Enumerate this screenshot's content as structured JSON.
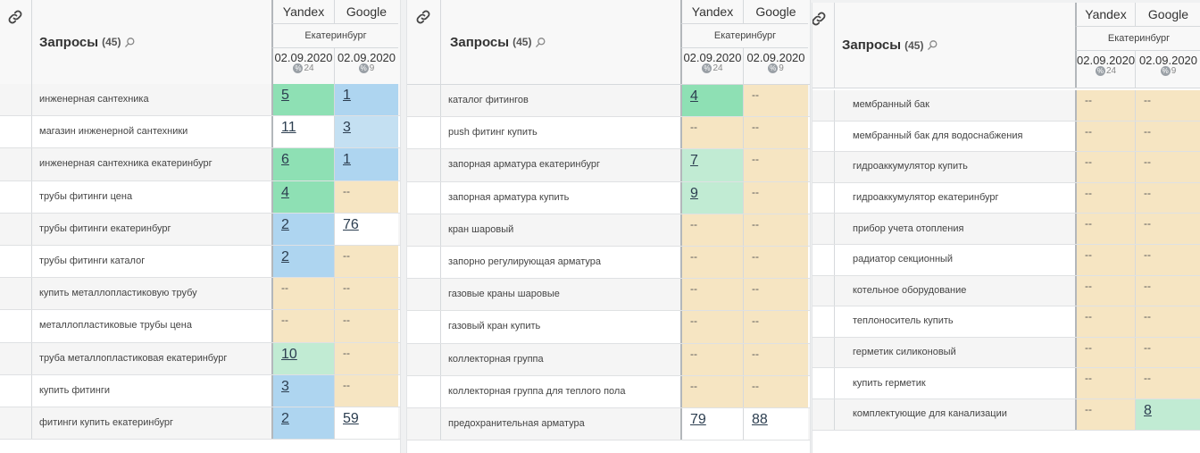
{
  "colors": {
    "green": "#8ee0b4",
    "lightgreen": "#c1ebd3",
    "blue": "#aed5f0",
    "lightblue": "#c4e0f2",
    "beige": "#f6e5c2",
    "white": "#ffffff"
  },
  "icons": {
    "link": "link-icon",
    "search": "search-icon",
    "percent": "percent-icon"
  },
  "panels": [
    {
      "header": {
        "title": "Запросы",
        "count": "(45)",
        "yandex": "Yandex",
        "google": "Google",
        "region": "Екатеринбург",
        "yandex_date": "02.09.2020",
        "yandex_sub": "24",
        "google_date": "02.09.2020",
        "google_sub": "9",
        "percent_symbol": "%"
      },
      "rows": [
        {
          "query": "инженерная сантехника",
          "yandex": "5",
          "google": "1",
          "y_color": "green",
          "g_color": "blue"
        },
        {
          "query": "магазин инженерной сантехники",
          "yandex": "11",
          "google": "3",
          "y_color": "white",
          "g_color": "lightblue"
        },
        {
          "query": "инженерная сантехника екатеринбург",
          "yandex": "6",
          "google": "1",
          "y_color": "green",
          "g_color": "blue"
        },
        {
          "query": "трубы фитинги цена",
          "yandex": "4",
          "google": "--",
          "y_color": "green",
          "g_color": "beige"
        },
        {
          "query": "трубы фитинги екатеринбург",
          "yandex": "2",
          "google": "76",
          "y_color": "blue",
          "g_color": "white"
        },
        {
          "query": "трубы фитинги каталог",
          "yandex": "2",
          "google": "--",
          "y_color": "blue",
          "g_color": "beige"
        },
        {
          "query": "купить металлопластиковую трубу",
          "yandex": "--",
          "google": "--",
          "y_color": "beige",
          "g_color": "beige"
        },
        {
          "query": "металлопластиковые трубы цена",
          "yandex": "--",
          "google": "--",
          "y_color": "beige",
          "g_color": "beige"
        },
        {
          "query": "труба металлопластиковая екатеринбург",
          "yandex": "10",
          "google": "--",
          "y_color": "lightgreen",
          "g_color": "beige"
        },
        {
          "query": "купить фитинги",
          "yandex": "3",
          "google": "--",
          "y_color": "blue",
          "g_color": "beige"
        },
        {
          "query": "фитинги купить екатеринбург",
          "yandex": "2",
          "google": "59",
          "y_color": "blue",
          "g_color": "white"
        }
      ]
    },
    {
      "header": {
        "title": "Запросы",
        "count": "(45)",
        "yandex": "Yandex",
        "google": "Google",
        "region": "Екатеринбург",
        "yandex_date": "02.09.2020",
        "yandex_sub": "24",
        "google_date": "02.09.2020",
        "google_sub": "9",
        "percent_symbol": "%"
      },
      "rows": [
        {
          "query": "каталог фитингов",
          "yandex": "4",
          "google": "--",
          "y_color": "green",
          "g_color": "beige"
        },
        {
          "query": "push фитинг купить",
          "yandex": "--",
          "google": "--",
          "y_color": "beige",
          "g_color": "beige"
        },
        {
          "query": "запорная арматура екатеринбург",
          "yandex": "7",
          "google": "--",
          "y_color": "lightgreen",
          "g_color": "beige"
        },
        {
          "query": "запорная арматура купить",
          "yandex": "9",
          "google": "--",
          "y_color": "lightgreen",
          "g_color": "beige"
        },
        {
          "query": "кран шаровый",
          "yandex": "--",
          "google": "--",
          "y_color": "beige",
          "g_color": "beige"
        },
        {
          "query": "запорно регулирующая арматура",
          "yandex": "--",
          "google": "--",
          "y_color": "beige",
          "g_color": "beige"
        },
        {
          "query": "газовые краны шаровые",
          "yandex": "--",
          "google": "--",
          "y_color": "beige",
          "g_color": "beige"
        },
        {
          "query": "газовый кран купить",
          "yandex": "--",
          "google": "--",
          "y_color": "beige",
          "g_color": "beige"
        },
        {
          "query": "коллекторная группа",
          "yandex": "--",
          "google": "--",
          "y_color": "beige",
          "g_color": "beige"
        },
        {
          "query": "коллекторная группа для теплого пола",
          "yandex": "--",
          "google": "--",
          "y_color": "beige",
          "g_color": "beige"
        },
        {
          "query": "предохранительная арматура",
          "yandex": "79",
          "google": "88",
          "y_color": "white",
          "g_color": "white"
        }
      ]
    },
    {
      "header": {
        "title": "Запросы",
        "count": "(45)",
        "yandex": "Yandex",
        "google": "Google",
        "region": "Екатеринбург",
        "yandex_date": "02.09.2020",
        "yandex_sub": "24",
        "google_date": "02.09.2020",
        "google_sub": "9",
        "percent_symbol": "%"
      },
      "rows": [
        {
          "query": "мембранный бак",
          "yandex": "--",
          "google": "--",
          "y_color": "beige",
          "g_color": "beige"
        },
        {
          "query": "мембранный бак для водоснабжения",
          "yandex": "--",
          "google": "--",
          "y_color": "beige",
          "g_color": "beige"
        },
        {
          "query": "гидроаккумулятор купить",
          "yandex": "--",
          "google": "--",
          "y_color": "beige",
          "g_color": "beige"
        },
        {
          "query": "гидроаккумулятор екатеринбург",
          "yandex": "--",
          "google": "--",
          "y_color": "beige",
          "g_color": "beige"
        },
        {
          "query": "прибор учета отопления",
          "yandex": "--",
          "google": "--",
          "y_color": "beige",
          "g_color": "beige"
        },
        {
          "query": "радиатор секционный",
          "yandex": "--",
          "google": "--",
          "y_color": "beige",
          "g_color": "beige"
        },
        {
          "query": "котельное оборудование",
          "yandex": "--",
          "google": "--",
          "y_color": "beige",
          "g_color": "beige"
        },
        {
          "query": "теплоноситель купить",
          "yandex": "--",
          "google": "--",
          "y_color": "beige",
          "g_color": "beige"
        },
        {
          "query": "герметик силиконовый",
          "yandex": "--",
          "google": "--",
          "y_color": "beige",
          "g_color": "beige"
        },
        {
          "query": "купить герметик",
          "yandex": "--",
          "google": "--",
          "y_color": "beige",
          "g_color": "beige"
        },
        {
          "query": "комплектующие для канализации",
          "yandex": "--",
          "google": "8",
          "y_color": "beige",
          "g_color": "lightgreen"
        }
      ]
    }
  ]
}
